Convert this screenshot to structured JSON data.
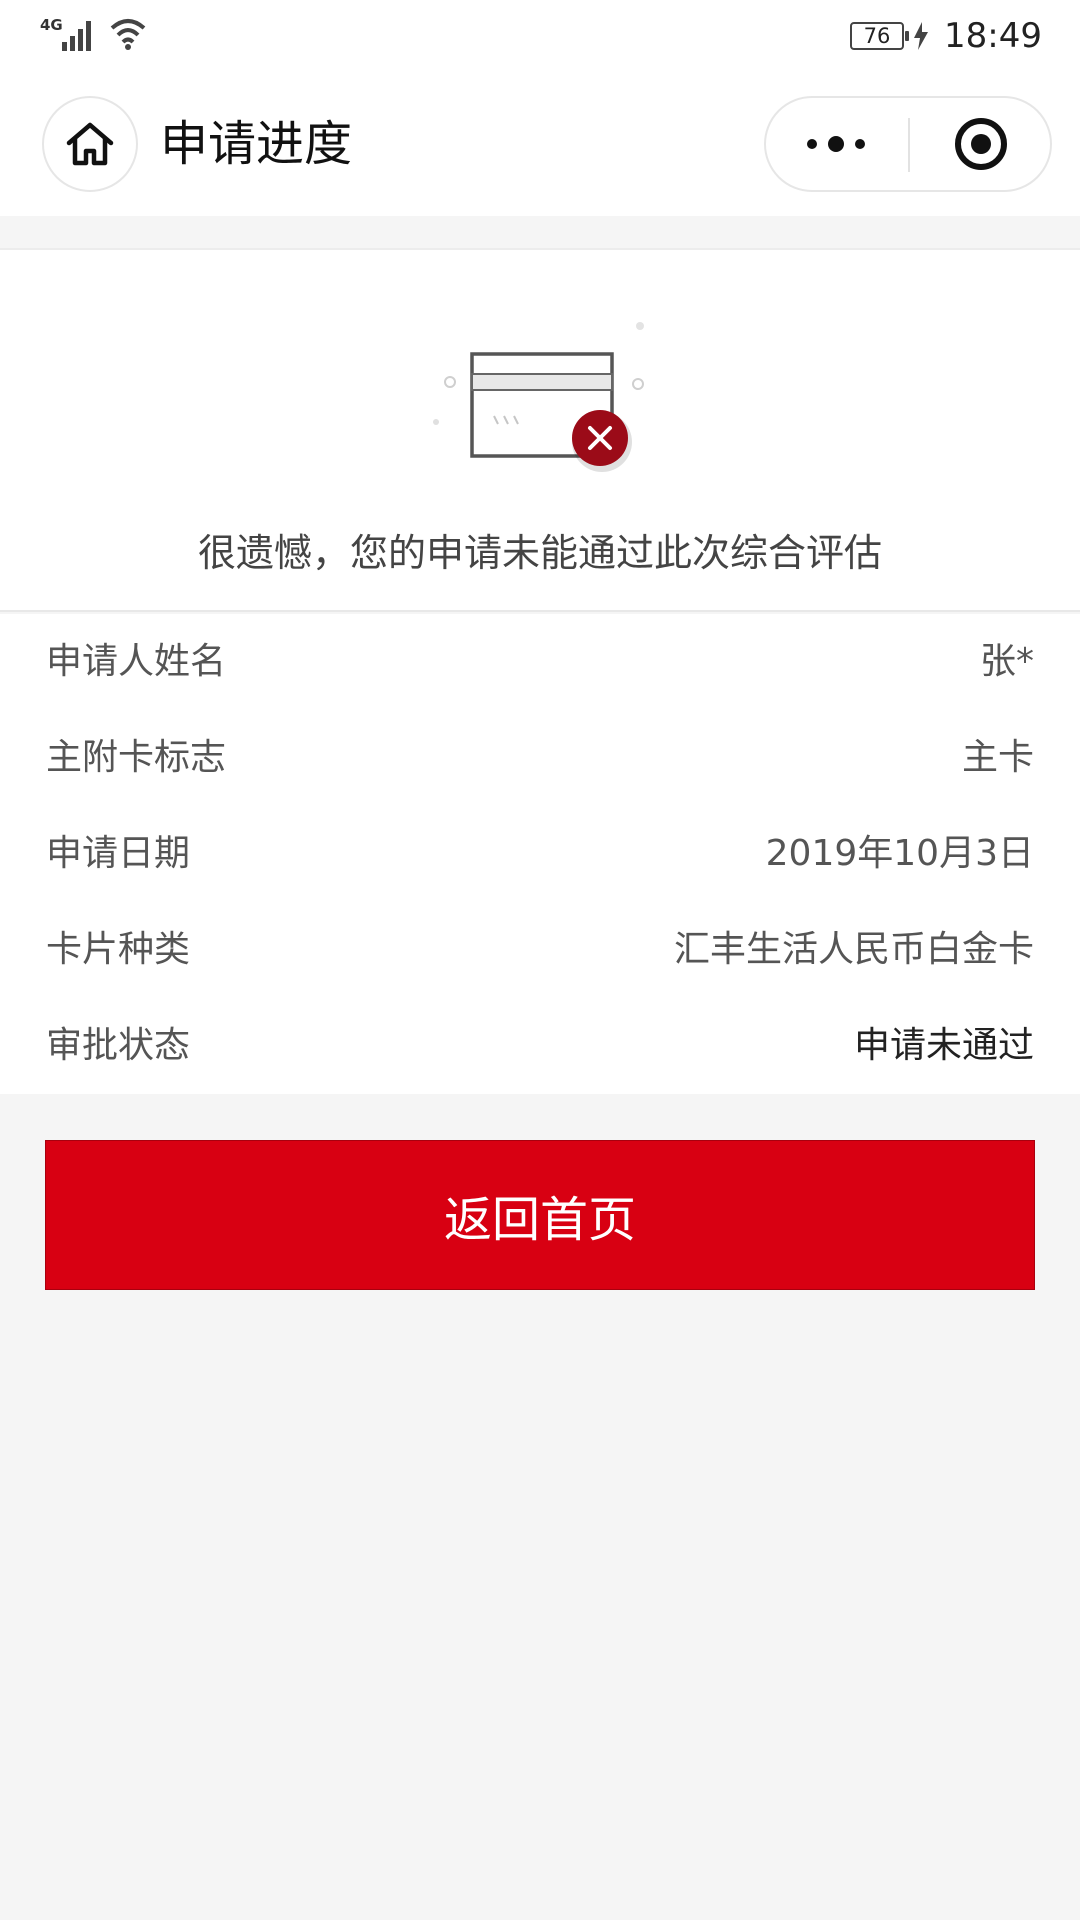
{
  "status_bar": {
    "network": "4G",
    "battery": "76",
    "time": "18:49",
    "icons": [
      "signal-icon",
      "wifi-icon",
      "battery-icon",
      "charging-icon"
    ]
  },
  "nav": {
    "title": "申请进度",
    "icons": [
      "home-icon",
      "more-icon",
      "close-target-icon"
    ]
  },
  "result": {
    "illustration": "card-rejected-icon",
    "message": "很遗憾，您的申请未能通过此次综合评估"
  },
  "info": {
    "rows": [
      {
        "label": "申请人姓名",
        "value": "张*"
      },
      {
        "label": "主附卡标志",
        "value": "主卡"
      },
      {
        "label": "申请日期",
        "value": "2019年10月3日"
      },
      {
        "label": "卡片种类",
        "value": "汇丰生活人民币白金卡"
      },
      {
        "label": "审批状态",
        "value": "申请未通过"
      }
    ]
  },
  "actions": {
    "back_home": "返回首页"
  },
  "colors": {
    "accent": "#d80012",
    "background": "#f5f5f5",
    "surface": "#ffffff"
  }
}
